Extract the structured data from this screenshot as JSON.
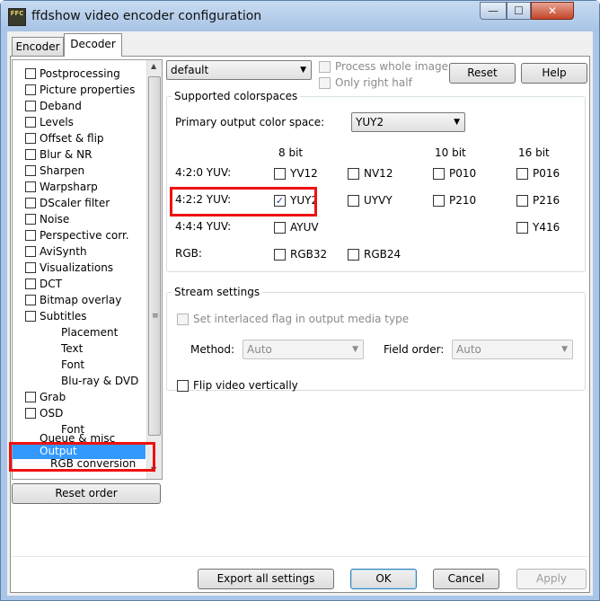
{
  "window": {
    "title": "ffdshow video encoder configuration",
    "icon_text": "FFC"
  },
  "captions": {
    "minimize": "—",
    "maximize": "☐",
    "close": "✕"
  },
  "tabs": [
    {
      "label": "Encoder"
    },
    {
      "label": "Decoder"
    }
  ],
  "tree": {
    "items": [
      {
        "label": "Postprocessing"
      },
      {
        "label": "Picture properties"
      },
      {
        "label": "Deband"
      },
      {
        "label": "Levels"
      },
      {
        "label": "Offset & flip"
      },
      {
        "label": "Blur & NR"
      },
      {
        "label": "Sharpen"
      },
      {
        "label": "Warpsharp"
      },
      {
        "label": "DScaler filter"
      },
      {
        "label": "Noise"
      },
      {
        "label": "Perspective corr."
      },
      {
        "label": "AviSynth"
      },
      {
        "label": "Visualizations"
      },
      {
        "label": "DCT"
      },
      {
        "label": "Bitmap overlay"
      },
      {
        "label": "Subtitles"
      },
      {
        "label": "Placement"
      },
      {
        "label": "Text"
      },
      {
        "label": "Font"
      },
      {
        "label": "Blu-ray & DVD"
      },
      {
        "label": "Grab"
      },
      {
        "label": "OSD"
      },
      {
        "label": "Font"
      },
      {
        "label": "Queue & misc"
      },
      {
        "label": "Output"
      },
      {
        "label": "RGB conversion"
      }
    ],
    "selected": "Output"
  },
  "reset_order_label": "Reset order",
  "preset": {
    "value": "default"
  },
  "process_whole_image": {
    "label": "Process whole image",
    "checked": false,
    "enabled": false
  },
  "only_right_half": {
    "label": "Only right half",
    "checked": false,
    "enabled": false
  },
  "reset_label": "Reset",
  "help_label": "Help",
  "colorspaces": {
    "group_title": "Supported colorspaces",
    "primary_label": "Primary output color space:",
    "primary_value": "YUY2",
    "headers": {
      "bit8": "8 bit",
      "bit10": "10 bit",
      "bit16": "16 bit"
    },
    "rows": {
      "r420": "4:2:0 YUV:",
      "r422": "4:2:2 YUV:",
      "r444": "4:4:4 YUV:",
      "rgb": "RGB:"
    },
    "boxes": {
      "yv12": {
        "label": "YV12",
        "checked": false
      },
      "nv12": {
        "label": "NV12",
        "checked": false
      },
      "p010": {
        "label": "P010",
        "checked": false
      },
      "p016": {
        "label": "P016",
        "checked": false
      },
      "yuy2": {
        "label": "YUY2",
        "checked": true
      },
      "uyvy": {
        "label": "UYVY",
        "checked": false
      },
      "p210": {
        "label": "P210",
        "checked": false
      },
      "p216": {
        "label": "P216",
        "checked": false
      },
      "ayuv": {
        "label": "AYUV",
        "checked": false
      },
      "y416": {
        "label": "Y416",
        "checked": false
      },
      "rgb32": {
        "label": "RGB32",
        "checked": false
      },
      "rgb24": {
        "label": "RGB24",
        "checked": false
      }
    }
  },
  "stream": {
    "group_title": "Stream settings",
    "interlaced_label": "Set interlaced flag in output media type",
    "method_label": "Method:",
    "method_value": "Auto",
    "field_order_label": "Field order:",
    "field_order_value": "Auto",
    "flip_label": "Flip video vertically"
  },
  "footer": {
    "export": "Export all settings",
    "ok": "OK",
    "cancel": "Cancel",
    "apply": "Apply"
  },
  "check_glyph": "✓",
  "dropdown_glyph": "▼",
  "highlight_color": "#ee1111"
}
